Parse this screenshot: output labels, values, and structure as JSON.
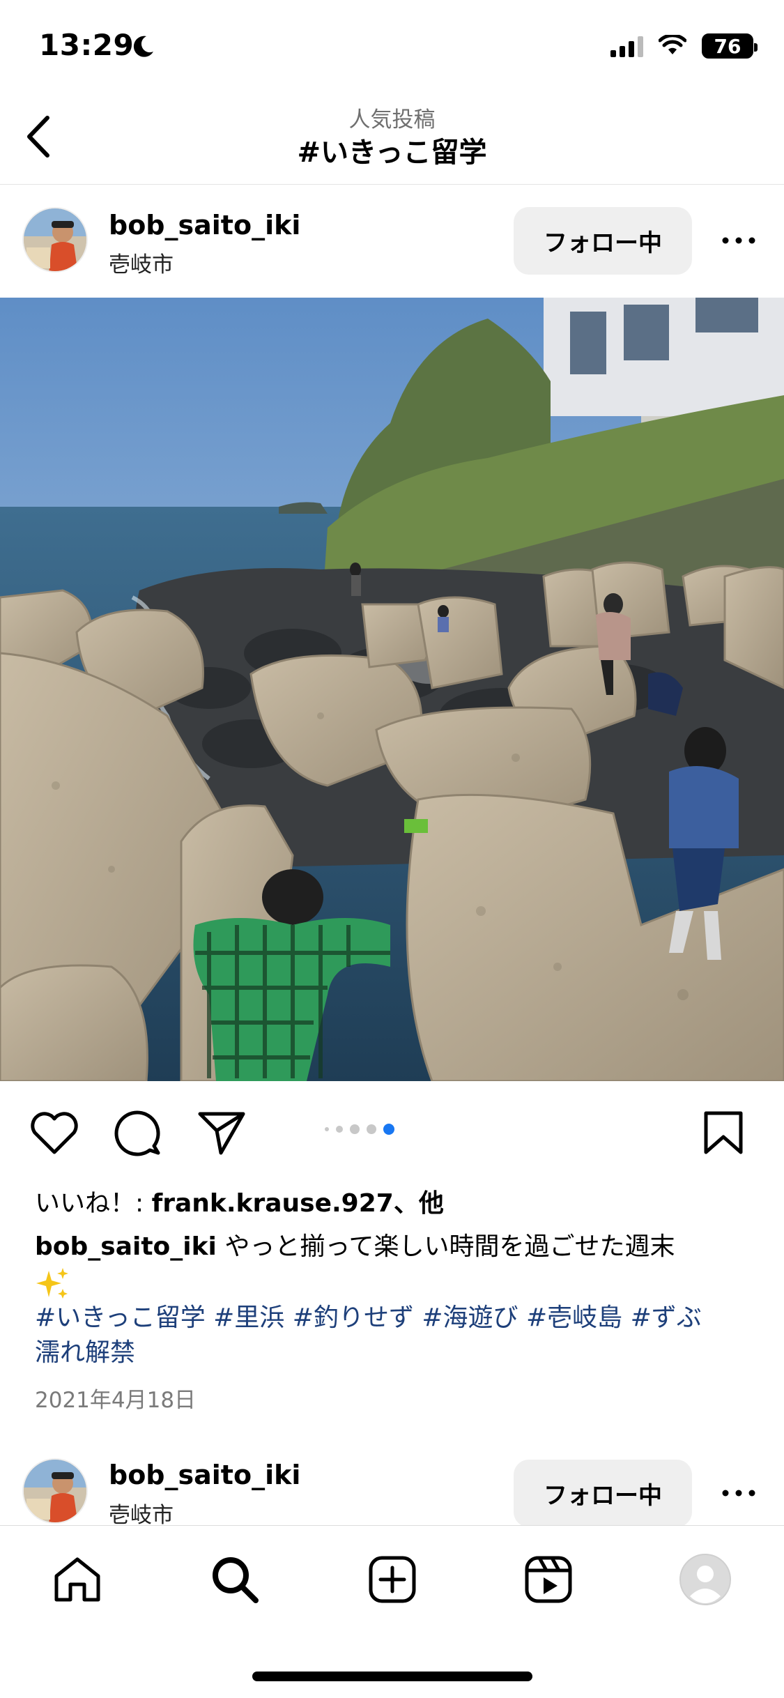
{
  "status_bar": {
    "time": "13:29",
    "battery": "76"
  },
  "header": {
    "subtitle": "人気投稿",
    "title": "#いきっこ留学"
  },
  "post": {
    "username": "bob_saito_iki",
    "location": "壱岐市",
    "follow_label": "フォロー中",
    "carousel": {
      "count": 5,
      "active_index": 4
    },
    "likes_prefix": "いいね！: ",
    "likes_user": "frank.krause.927",
    "likes_suffix": "、他",
    "caption_text": " やっと揃って楽しい時間を過ごせた週末",
    "hashtags_line1": "#いきっこ留学 #里浜 #釣りせず #海遊び #壱岐島 #ずぶ",
    "hashtags_line2": "濡れ解禁",
    "date": "2021年4月18日"
  },
  "next_post": {
    "username": "bob_saito_iki",
    "location": "壱岐市",
    "follow_label": "フォロー中"
  },
  "tabs": [
    "home-icon",
    "search-icon",
    "create-icon",
    "reels-icon",
    "profile-icon"
  ],
  "colors": {
    "hashtag": "#1d3f7a",
    "active_dot": "#1877f2",
    "follow_bg": "#efefef"
  }
}
